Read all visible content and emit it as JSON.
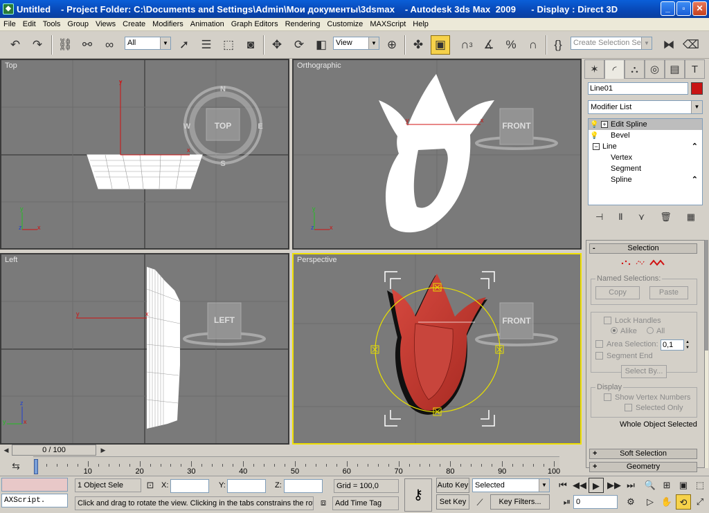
{
  "titlebar": {
    "title": "Untitled    - Project Folder: C:\\Documents and Settings\\Admin\\Мои документы\\3dsmax    - Autodesk 3ds Max  2009      - Display : Direct 3D",
    "min": "_",
    "max": "▫",
    "close": "✕"
  },
  "menu": [
    "File",
    "Edit",
    "Tools",
    "Group",
    "Views",
    "Create",
    "Modifiers",
    "Animation",
    "Graph Editors",
    "Rendering",
    "Customize",
    "MAXScript",
    "Help"
  ],
  "toolbar": {
    "selection_filter": "All",
    "ref_coord": "View",
    "named_selection_placeholder": "Create Selection Set",
    "snap_angle_label": "3"
  },
  "viewports": {
    "top": {
      "label": "Top",
      "cube": "TOP",
      "compass": [
        "N",
        "S",
        "W",
        "E"
      ]
    },
    "ortho": {
      "label": "Orthographic",
      "cube": "FRONT"
    },
    "left": {
      "label": "Left",
      "cube": "LEFT"
    },
    "persp": {
      "label": "Perspective",
      "cube": "FRONT"
    },
    "axes": {
      "x": "x",
      "y": "y",
      "z": "z"
    }
  },
  "command_panel": {
    "object_name": "Line01",
    "object_color": "#c81414",
    "modifier_list": "Modifier List",
    "stack": [
      {
        "label": "Edit Spline",
        "selected": true,
        "icon": "bulb-icon"
      },
      {
        "label": "Bevel",
        "selected": false,
        "icon": "bulb-icon"
      },
      {
        "label": "Line",
        "selected": false,
        "icon": "expand-icon"
      },
      {
        "label": "Vertex",
        "selected": false
      },
      {
        "label": "Segment",
        "selected": false
      },
      {
        "label": "Spline",
        "selected": false
      }
    ],
    "selection_rollout": {
      "title": "Selection",
      "named_selections": "Named Selections:",
      "copy": "Copy",
      "paste": "Paste",
      "lock_handles": "Lock Handles",
      "alike": "Alike",
      "all": "All",
      "area_selection": "Area Selection:",
      "area_value": "0,1",
      "segment_end": "Segment End",
      "select_by": "Select By...",
      "display": "Display",
      "show_vertex_numbers": "Show Vertex Numbers",
      "selected_only": "Selected Only",
      "status": "Whole Object Selected"
    },
    "soft_selection": "Soft Selection",
    "geometry": "Geometry"
  },
  "time": {
    "slider": "0 / 100",
    "ticks": [
      0,
      10,
      20,
      30,
      40,
      50,
      60,
      70,
      80,
      90,
      100
    ]
  },
  "status": {
    "maxscript": "AXScript.",
    "objects_selected": "1 Object Sele",
    "x_label": "X:",
    "y_label": "Y:",
    "z_label": "Z:",
    "grid": "Grid = 100,0",
    "prompt": "Click and drag to rotate the view.  Clicking in the tabs constrains the rota",
    "add_time_tag": "Add Time Tag",
    "auto_key": "Auto Key",
    "set_key": "Set Key",
    "key_mode": "Selected",
    "key_filters": "Key Filters...",
    "frame": "0"
  }
}
